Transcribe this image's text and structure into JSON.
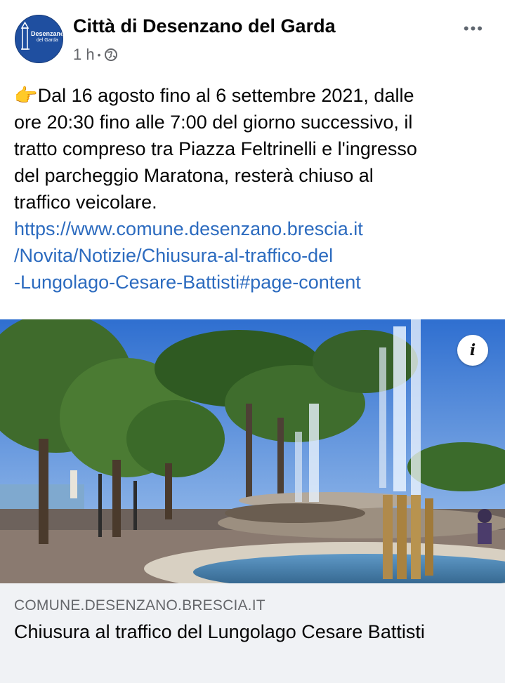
{
  "post": {
    "page_name": "Città di Desenzano del Garda",
    "avatar_text": "Desenzano",
    "avatar_subtext": "del Garda",
    "time": "1 h",
    "separator": "•",
    "privacy_icon": "globe-icon",
    "more_icon": "ellipsis-icon",
    "emoji": "👉",
    "text_lines": [
      "Dal 16 agosto fino al 6 settembre 2021, dalle",
      "ore 20:30 fino alle 7:00 del giorno successivo, il",
      "tratto compreso tra Piazza Feltrinelli e l'ingresso",
      "del parcheggio Maratona, resterà chiuso al",
      "traffico veicolare."
    ],
    "link_lines": [
      "https://www.comune.desenzano.brescia.it",
      "/Novita/Notizie/Chiusura-al-traffico-del",
      "-Lungolago-Cesare-Battisti#page-content"
    ]
  },
  "preview": {
    "info_label": "i",
    "domain": "COMUNE.DESENZANO.BRESCIA.IT",
    "headline": "Chiusura al traffico del Lungolago Cesare Battisti"
  },
  "colors": {
    "link": "#2c6bbf",
    "meta": "#65676b",
    "preview_bg": "#f0f2f5"
  }
}
